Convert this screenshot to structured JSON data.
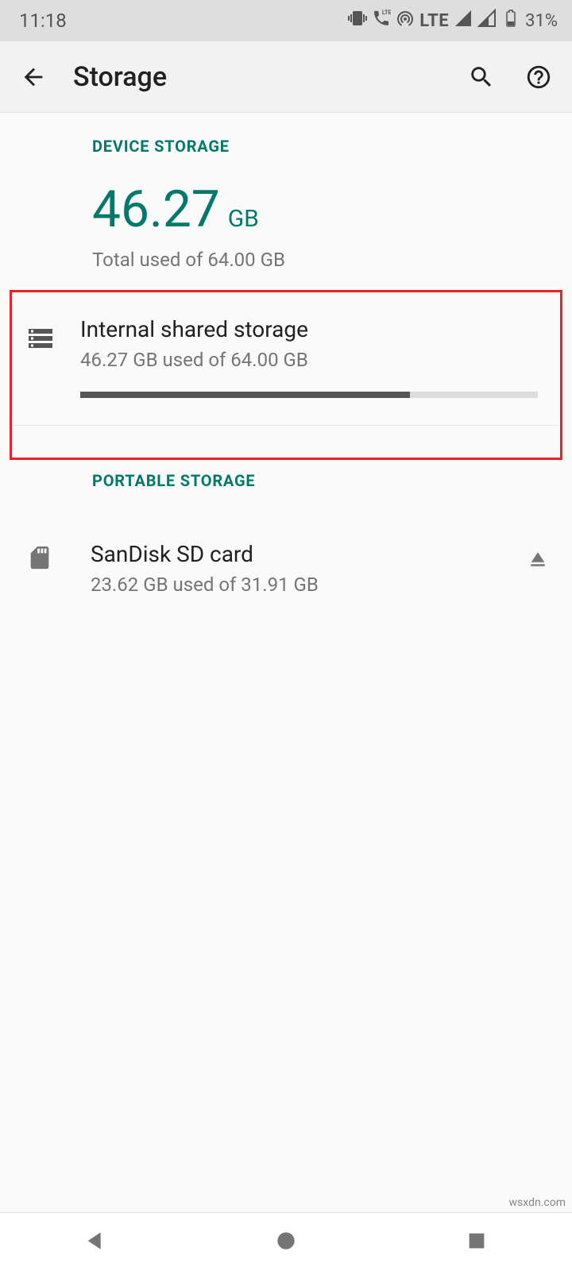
{
  "status": {
    "time": "11:18",
    "battery_pct": "31%"
  },
  "header": {
    "title": "Storage"
  },
  "device_storage": {
    "label": "DEVICE STORAGE",
    "used_value": "46.27",
    "used_unit": "GB",
    "subtitle": "Total used of 64.00 GB"
  },
  "internal": {
    "title": "Internal shared storage",
    "subtitle": "46.27 GB used of 64.00 GB",
    "fill_pct": 72
  },
  "portable": {
    "label": "PORTABLE STORAGE"
  },
  "sd": {
    "title": "SanDisk SD card",
    "subtitle": "23.62 GB used of 31.91 GB"
  },
  "watermark": "wsxdn.com"
}
